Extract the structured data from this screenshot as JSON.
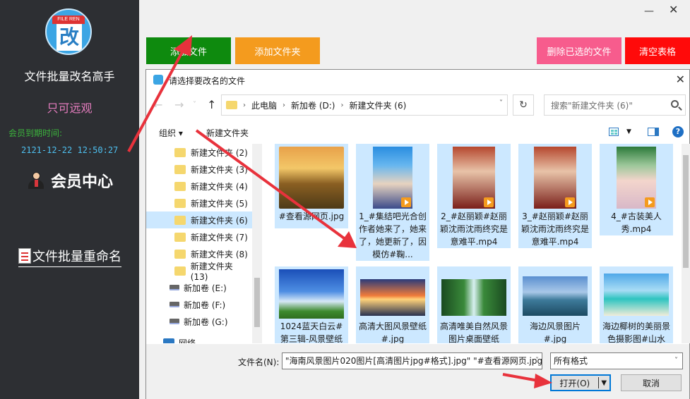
{
  "left_panel": {
    "logo_text": "FILE REN",
    "logo_glyph": "改",
    "app_title": "文件批量改名高手",
    "readonly_label": "只可远观",
    "member_expire_label": "会员到期时间:",
    "member_expire_date": "2121-12-22 12:50:27",
    "member_center": "会员中心",
    "rename_menu": "文件批量重命名"
  },
  "top": {
    "minimize": "—",
    "close": "✕",
    "btn_add_file": "添加文件",
    "btn_add_folder": "添加文件夹",
    "btn_delete_selected": "删除已选的文件",
    "btn_clear_table": "清空表格"
  },
  "dialog": {
    "title": "请选择要改名的文件",
    "close": "✕",
    "nav": {
      "back": "←",
      "forward": "→",
      "recent": "˅",
      "up": "↑"
    },
    "breadcrumb": [
      "此电脑",
      "新加卷 (D:)",
      "新建文件夹 (6)"
    ],
    "refresh": "↻",
    "search_placeholder": "搜索\"新建文件夹 (6)\"",
    "toolbar": {
      "organize": "组织 ▾",
      "new_folder": "新建文件夹",
      "help": "?"
    },
    "tree": [
      {
        "label": "新建文件夹 (2)",
        "type": "folder"
      },
      {
        "label": "新建文件夹 (3)",
        "type": "folder"
      },
      {
        "label": "新建文件夹 (4)",
        "type": "folder"
      },
      {
        "label": "新建文件夹 (5)",
        "type": "folder"
      },
      {
        "label": "新建文件夹 (6)",
        "type": "folder",
        "selected": true
      },
      {
        "label": "新建文件夹 (7)",
        "type": "folder"
      },
      {
        "label": "新建文件夹 (8)",
        "type": "folder"
      },
      {
        "label": "新建文件夹 (13)",
        "type": "folder"
      },
      {
        "label": "新加卷 (E:)",
        "type": "drive"
      },
      {
        "label": "新加卷 (F:)",
        "type": "drive"
      },
      {
        "label": "新加卷 (G:)",
        "type": "drive"
      },
      {
        "label": "网络",
        "type": "network"
      }
    ],
    "files": [
      {
        "name": "#查看源网页.jpg",
        "kind": "image",
        "theme": "autumn"
      },
      {
        "name": "1_#集结吧光合创作者她来了，她来了，她更新了，因模仿#鞠...",
        "kind": "video",
        "theme": "person"
      },
      {
        "name": "2_#赵丽颖#赵丽颖沈雨沈雨终究是意难平.mp4",
        "kind": "video",
        "theme": "person"
      },
      {
        "name": "3_#赵丽颖#赵丽颖沈雨沈雨终究是意难平.mp4",
        "kind": "video",
        "theme": "person"
      },
      {
        "name": "4_#古装美人秀.mp4",
        "kind": "video",
        "theme": "person"
      },
      {
        "name": "1024蓝天白云#第三辑-风景壁纸",
        "kind": "image",
        "theme": "sky"
      },
      {
        "name": "高清大图风景壁纸#.jpg",
        "kind": "image",
        "theme": "sunset"
      },
      {
        "name": "高清唯美自然风景图片桌面壁纸",
        "kind": "image",
        "theme": "waterfall"
      },
      {
        "name": "海边风景图片#.jpg",
        "kind": "image",
        "theme": "sea"
      },
      {
        "name": "海边椰树的美丽景色摄影图#山水",
        "kind": "image",
        "theme": "beach"
      }
    ],
    "filename_label": "文件名(N):",
    "filename_value": "\"海南风景图片020图片[高清图片jpg#格式].jpg\" \"#查看源网页.jpg\"",
    "filetype_value": "所有格式",
    "open_label": "打开(O)",
    "cancel_label": "取消"
  },
  "colors": {
    "add_file": "#0e8a0e",
    "add_folder": "#f49b1e",
    "delete_selected": "#f75c8d",
    "clear_table": "#ff0a0a",
    "annotation_arrow": "#e8323c"
  }
}
